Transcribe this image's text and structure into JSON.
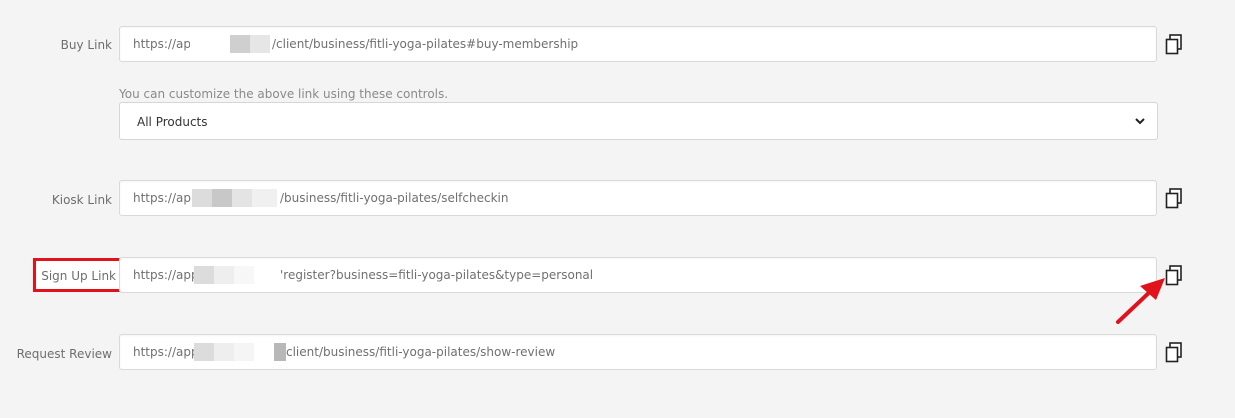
{
  "rows": {
    "buy": {
      "label": "Buy Link",
      "prefix": "https://app",
      "suffix": "/client/business/fitli-yoga-pilates#buy-membership"
    },
    "hint": "You can customize the above link using these controls.",
    "select": {
      "value": "All Products"
    },
    "kiosk": {
      "label": "Kiosk Link",
      "prefix": "https://app",
      "suffix": "/business/fitli-yoga-pilates/selfcheckin"
    },
    "signup": {
      "label": "Sign Up Link",
      "prefix": "https://app",
      "suffix": "'register?business=fitli-yoga-pilates&type=personal"
    },
    "review": {
      "label": "Request Review",
      "prefix": "https://app",
      "suffix": "client/business/fitli-yoga-pilates/show-review"
    }
  },
  "icons": {
    "copy": "copy-icon",
    "chevron": "chevron-down-icon",
    "arrow": "arrow-annotation-icon"
  },
  "colors": {
    "highlight": "#e0121c",
    "redaction": "#d0d0d0"
  }
}
